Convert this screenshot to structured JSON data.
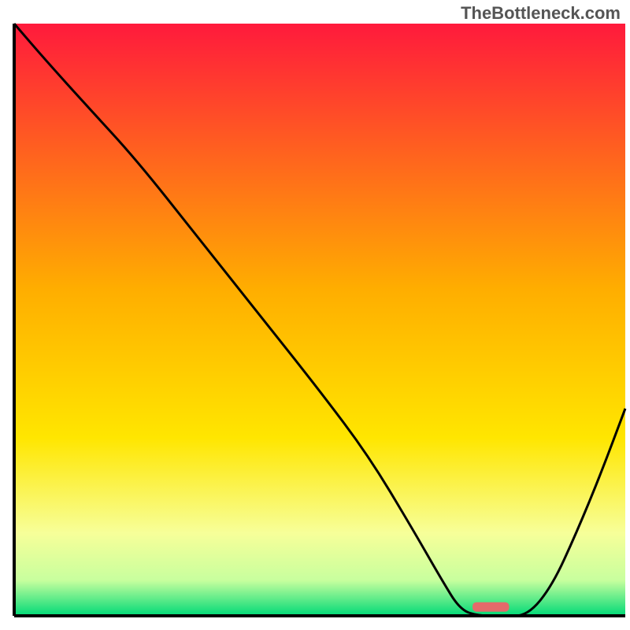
{
  "watermark": "TheBottleneck.com",
  "chart_data": {
    "type": "line",
    "title": "",
    "xlabel": "",
    "ylabel": "",
    "xlim": [
      0,
      100
    ],
    "ylim": [
      0,
      100
    ],
    "grid": false,
    "legend": false,
    "background_gradient": {
      "stops": [
        {
          "offset": 0.0,
          "color": "#ff1a3c"
        },
        {
          "offset": 0.45,
          "color": "#ffae00"
        },
        {
          "offset": 0.7,
          "color": "#ffe600"
        },
        {
          "offset": 0.86,
          "color": "#f7ff99"
        },
        {
          "offset": 0.94,
          "color": "#c8ff9e"
        },
        {
          "offset": 1.0,
          "color": "#00d977"
        }
      ]
    },
    "series": [
      {
        "name": "bottleneck-curve",
        "color": "#000000",
        "x": [
          0,
          5,
          12,
          20,
          30,
          40,
          50,
          58,
          65,
          70,
          73,
          76,
          80,
          84,
          88,
          92,
          96,
          100
        ],
        "y": [
          100,
          94,
          86,
          77,
          64,
          51,
          38,
          27,
          15,
          6,
          1,
          0,
          0,
          0,
          5,
          14,
          24,
          35
        ]
      }
    ],
    "marker": {
      "name": "optimal-point",
      "x": 78,
      "y": 1.5,
      "width": 6,
      "color": "#e46a6a"
    },
    "annotations": []
  }
}
